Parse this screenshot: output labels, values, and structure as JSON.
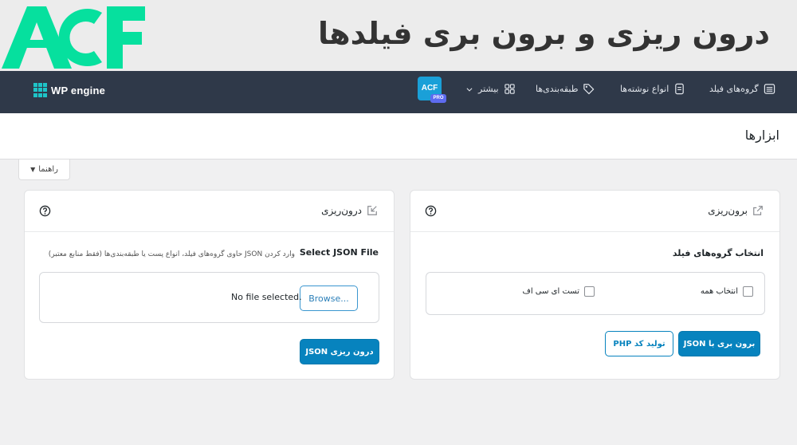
{
  "banner": {
    "logo_text": "ACF",
    "title": "درون ریزی و برون بری فیلدها"
  },
  "colors": {
    "acf_green": "#06e09e",
    "topnav_bg": "#2f3949",
    "primary_blue": "#0783be",
    "pro_badge": "#5d6bf0"
  },
  "topnav": {
    "brand_logo": "WP engine",
    "items": [
      {
        "label": "گروه‌های فیلد",
        "icon": "list-icon"
      },
      {
        "label": "انواع نوشته‌ها",
        "icon": "document-icon"
      },
      {
        "label": "طبقه‌بندی‌ها",
        "icon": "tag-icon"
      },
      {
        "label": "بیشتر",
        "icon": "grid-icon"
      }
    ],
    "acf_badge": {
      "text": "ACF",
      "pro": "PRO"
    }
  },
  "page": {
    "title": "ابزارها",
    "help_tab": "راهنما"
  },
  "export": {
    "title": "برون‌ریزی",
    "section_label": "انتخاب گروه‌های فیلد",
    "checkboxes": [
      {
        "label": "انتخاب همه",
        "checked": false
      },
      {
        "label": "تست ای سی اف",
        "checked": false
      }
    ],
    "export_json_button": "برون بری با JSON",
    "generate_php_button": "تولید کد PHP"
  },
  "import": {
    "title": "درون‌ریزی",
    "field_label": "Select JSON File",
    "description": "وارد کردن JSON حاوی گروه‌های فیلد، انواع پست یا طبقه‌بندی‌ها (فقط منابع معتبر)",
    "browse_button": "Browse...",
    "file_status": "No file selected.",
    "import_button": "درون ریزی JSON"
  }
}
